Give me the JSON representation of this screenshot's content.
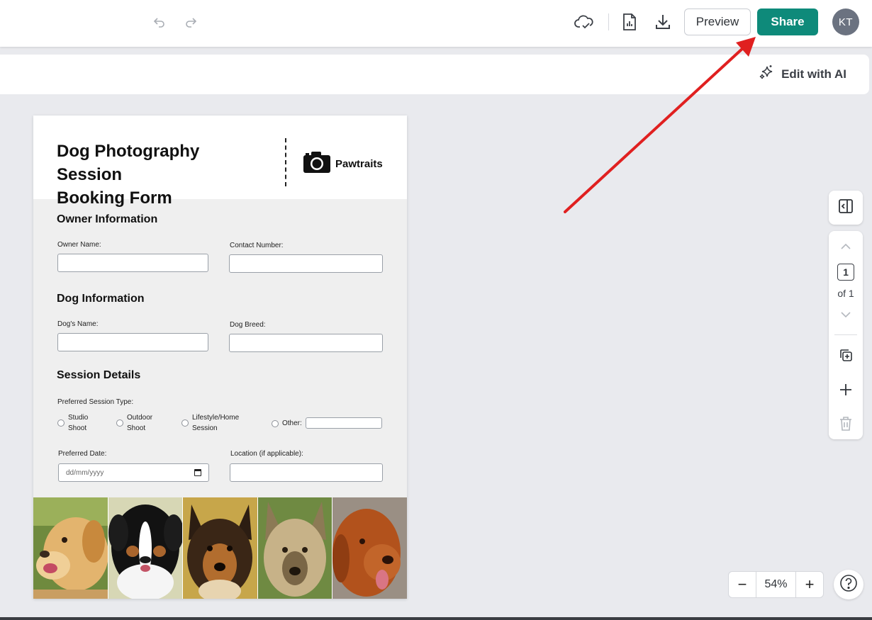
{
  "toolbar": {
    "undo_icon": "undo-icon",
    "redo_icon": "redo-icon",
    "cloud_icon": "cloud-saved-icon",
    "report_icon": "report-icon",
    "download_icon": "download-icon",
    "preview_label": "Preview",
    "share_label": "Share",
    "avatar_initials": "KT"
  },
  "ai_bar": {
    "label": "Edit with AI",
    "icon": "sparkles-icon"
  },
  "form": {
    "title_line1": "Dog Photography Session",
    "title_line2": "Booking Form",
    "brand": "Pawtraits",
    "owner_section": "Owner Information",
    "owner_name_label": "Owner Name:",
    "contact_label": "Contact Number:",
    "dog_section": "Dog Information",
    "dog_name_label": "Dog's Name:",
    "dog_breed_label": "Dog Breed:",
    "session_section": "Session Details",
    "session_type_label": "Preferred Session Type:",
    "session_options": [
      {
        "line1": "Studio",
        "line2": "Shoot"
      },
      {
        "line1": "Outdoor",
        "line2": "Shoot"
      },
      {
        "line1": "Lifestyle/Home",
        "line2": "Session"
      },
      {
        "line1": "Other:",
        "line2": ""
      }
    ],
    "date_label": "Preferred Date:",
    "date_placeholder": "dd/mm/yyyy",
    "location_label": "Location (if applicable):",
    "photos": [
      "golden-retriever-photo",
      "bernese-mountain-dog-photo",
      "collie-photo",
      "shepherd-dog-photo",
      "red-retriever-photo"
    ]
  },
  "side_panel": {
    "current_page": "1",
    "page_of": "of 1"
  },
  "zoom": {
    "minus": "−",
    "value": "54%",
    "plus": "+"
  },
  "help": {
    "icon": "help-icon",
    "label": "?"
  },
  "colors": {
    "share": "#0e8a7a",
    "annotation_arrow": "#e02020",
    "avatar": "#6b7280"
  }
}
